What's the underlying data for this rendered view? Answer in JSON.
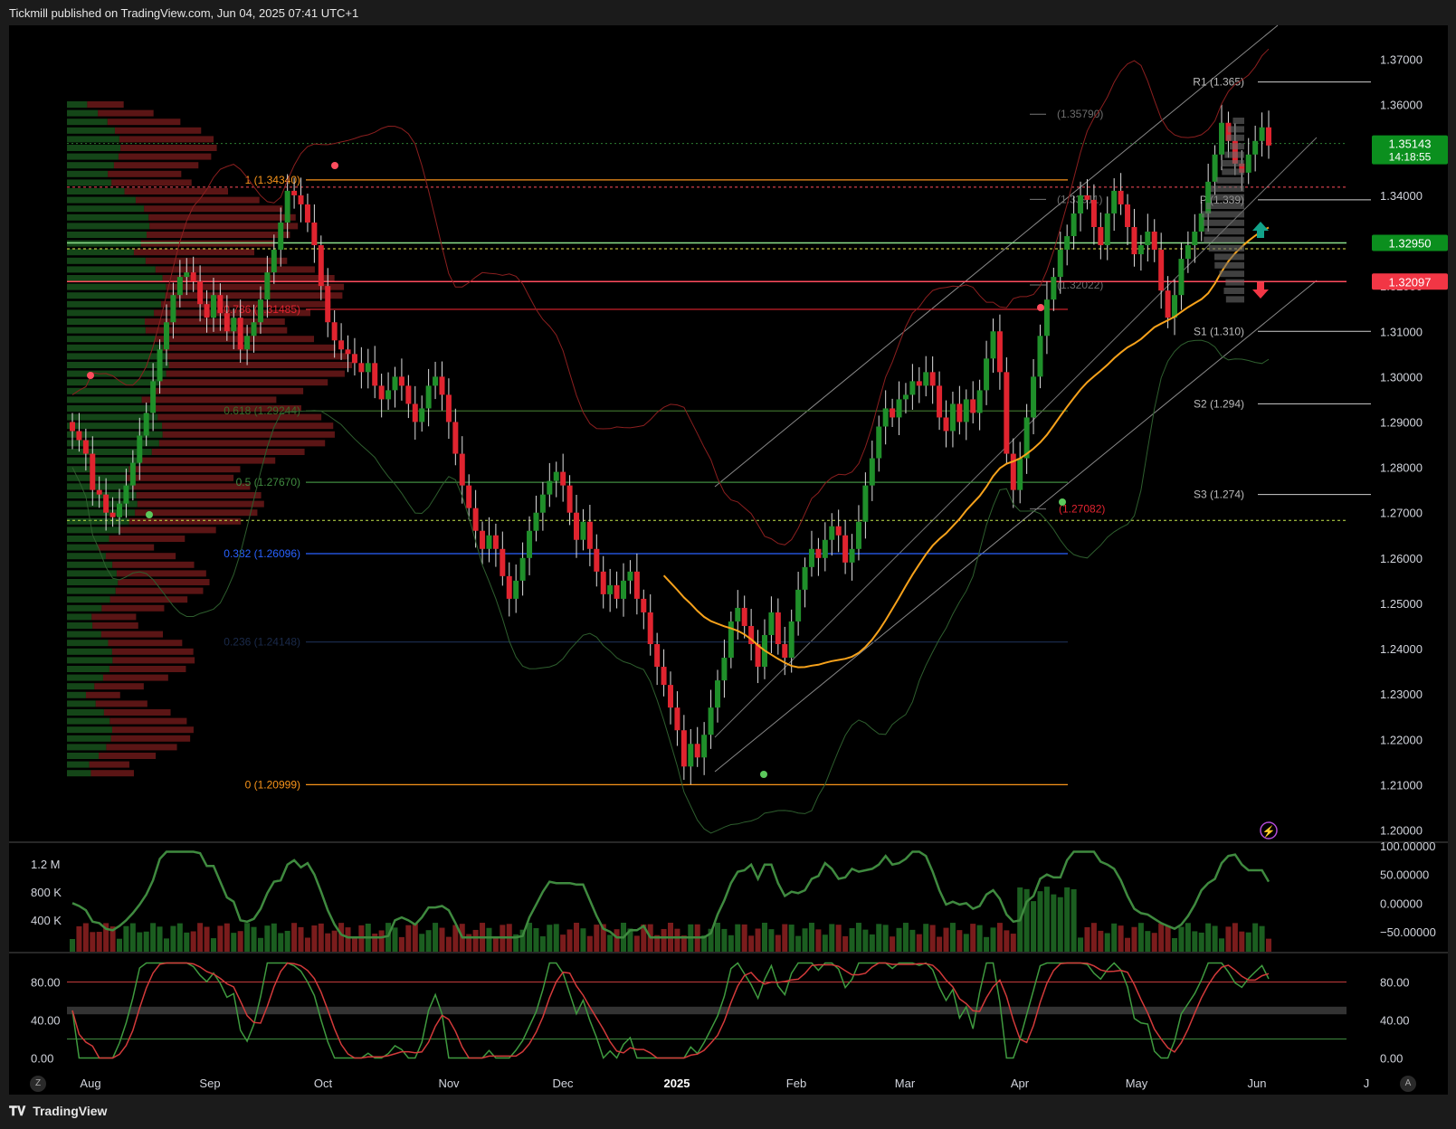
{
  "header": {
    "publisher_line": "Tickmill published on TradingView.com, Jun 04, 2025 07:41 UTC+1"
  },
  "footer": {
    "brand": "TradingView",
    "btn_left": "Z",
    "btn_right": "A"
  },
  "colors": {
    "background": "#000000",
    "frame": "#1b1b1b",
    "up": "#1f8f2a",
    "down": "#e0242f",
    "fib": "#f7931a",
    "sma": "#f7a21b",
    "price_badge": "#0b8f1e",
    "sell_badge": "#f23645",
    "grid_text": "#d1d4dc"
  },
  "chart_data": {
    "type": "candlestick",
    "symbol_note": "",
    "xlabels": [
      "Aug",
      "Sep",
      "Oct",
      "Nov",
      "Dec",
      "2025",
      "Feb",
      "Mar",
      "Apr",
      "May",
      "Jun",
      "J"
    ],
    "yaxis": {
      "ticks": [
        "1.37000",
        "1.36000",
        "1.35000",
        "1.34000",
        "1.33000",
        "1.32000",
        "1.31000",
        "1.30000",
        "1.29000",
        "1.28000",
        "1.27000",
        "1.26000",
        "1.25000",
        "1.24000",
        "1.23000",
        "1.22000",
        "1.21000",
        "1.20000"
      ],
      "range": [
        1.1975,
        1.3775
      ]
    },
    "last_price": {
      "value": "1.35143",
      "countdown": "14:18:55"
    },
    "price_badges": [
      {
        "value": "1.32950",
        "color": "#0b8f1e",
        "price": 1.3295
      },
      {
        "value": "1.32097",
        "color": "#f23645",
        "price": 1.32097
      }
    ],
    "fibonacci": [
      {
        "label": "1 (1.34340)",
        "price": 1.3434,
        "color": "#f7931a"
      },
      {
        "label": "0.786 (1.31485)",
        "price": 1.31485,
        "color": "#e0242f"
      },
      {
        "label": "0.618 (1.29244)",
        "price": 1.29244,
        "color": "#3a6b2a"
      },
      {
        "label": "0.5 (1.27670)",
        "price": 1.2767,
        "color": "#3f8a3f"
      },
      {
        "label": "0.382 (1.26096)",
        "price": 1.26096,
        "color": "#2962ff"
      },
      {
        "label": "0.236 (1.24148)",
        "price": 1.24148,
        "color": "#1a2a4a"
      },
      {
        "label": "0 (1.20999)",
        "price": 1.20999,
        "color": "#f7931a"
      }
    ],
    "pivots": [
      {
        "label": "R1 (1.365)",
        "price": 1.365
      },
      {
        "label": "P (1.339)",
        "price": 1.339
      },
      {
        "label": "S1 (1.310)",
        "price": 1.31
      },
      {
        "label": "S2 (1.294)",
        "price": 1.294
      },
      {
        "label": "S3 (1.274)",
        "price": 1.274
      }
    ],
    "level_labels": [
      {
        "label": "(1.35790)",
        "price": 1.3579
      },
      {
        "label": "(1.33911)",
        "price": 1.33911
      },
      {
        "label": "(1.32022)",
        "price": 1.32022
      },
      {
        "label": "(1.27082)",
        "price": 1.27082
      }
    ],
    "closes": [
      1.288,
      1.286,
      1.283,
      1.275,
      1.274,
      1.27,
      1.269,
      1.272,
      1.276,
      1.281,
      1.287,
      1.292,
      1.299,
      1.306,
      1.312,
      1.318,
      1.322,
      1.323,
      1.321,
      1.316,
      1.313,
      1.318,
      1.314,
      1.31,
      1.313,
      1.306,
      1.309,
      1.312,
      1.317,
      1.323,
      1.328,
      1.334,
      1.341,
      1.34,
      1.338,
      1.334,
      1.329,
      1.32,
      1.312,
      1.308,
      1.306,
      1.305,
      1.303,
      1.301,
      1.303,
      1.298,
      1.295,
      1.297,
      1.3,
      1.298,
      1.294,
      1.29,
      1.293,
      1.298,
      1.3,
      1.296,
      1.29,
      1.283,
      1.276,
      1.271,
      1.266,
      1.262,
      1.265,
      1.262,
      1.256,
      1.251,
      1.255,
      1.26,
      1.266,
      1.27,
      1.274,
      1.277,
      1.279,
      1.276,
      1.27,
      1.264,
      1.268,
      1.262,
      1.257,
      1.252,
      1.254,
      1.251,
      1.255,
      1.257,
      1.251,
      1.248,
      1.241,
      1.236,
      1.232,
      1.227,
      1.222,
      1.214,
      1.219,
      1.216,
      1.221,
      1.227,
      1.233,
      1.238,
      1.246,
      1.249,
      1.245,
      1.241,
      1.236,
      1.243,
      1.248,
      1.241,
      1.238,
      1.246,
      1.253,
      1.258,
      1.262,
      1.26,
      1.264,
      1.267,
      1.265,
      1.259,
      1.262,
      1.268,
      1.276,
      1.282,
      1.289,
      1.293,
      1.291,
      1.295,
      1.296,
      1.299,
      1.298,
      1.301,
      1.298,
      1.291,
      1.288,
      1.294,
      1.29,
      1.295,
      1.292,
      1.297,
      1.304,
      1.31,
      1.301,
      1.283,
      1.275,
      1.282,
      1.291,
      1.3,
      1.309,
      1.317,
      1.322,
      1.328,
      1.331,
      1.336,
      1.34,
      1.339,
      1.333,
      1.329,
      1.336,
      1.341,
      1.338,
      1.333,
      1.327,
      1.329,
      1.332,
      1.328,
      1.319,
      1.313,
      1.318,
      1.326,
      1.329,
      1.332,
      1.336,
      1.343,
      1.349,
      1.356,
      1.352,
      1.347,
      1.345,
      1.349,
      1.352,
      1.355,
      1.351
    ],
    "oscillator": {
      "ticks": [
        "100.00000",
        "50.00000",
        "0.00000",
        "−50.00000"
      ],
      "volume_ticks": [
        "1.2 M",
        "800 K",
        "400 K"
      ],
      "range": [
        -85,
        105
      ]
    },
    "stochastic": {
      "ticks_left": [
        "80.00",
        "40.00",
        "0.00"
      ],
      "ticks_right": [
        "80.00",
        "40.00",
        "0.00"
      ],
      "range": [
        -10,
        110
      ],
      "upper": 80,
      "lower": 20
    }
  }
}
